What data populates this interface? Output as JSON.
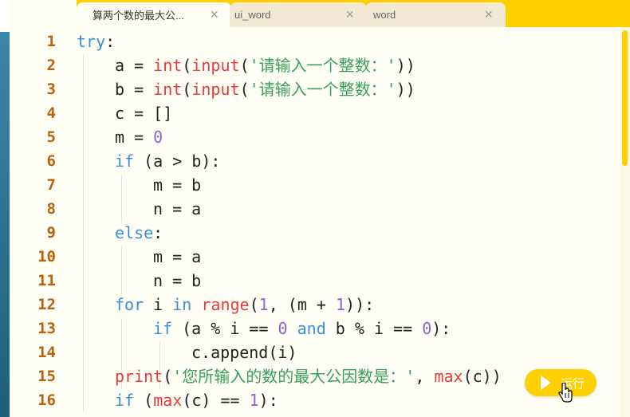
{
  "tabs": [
    {
      "label": "算两个数的最大公...",
      "active": true
    },
    {
      "label": "ui_word",
      "active": false
    },
    {
      "label": "word",
      "active": false
    }
  ],
  "close_glyph": "×",
  "run_button": {
    "label": "运行"
  },
  "line_numbers": [
    "1",
    "2",
    "3",
    "4",
    "5",
    "6",
    "7",
    "8",
    "9",
    "10",
    "11",
    "12",
    "13",
    "14",
    "15",
    "16"
  ],
  "code": {
    "l1": {
      "kw": "try",
      "rest": ":"
    },
    "l2": {
      "a": "a = ",
      "f1": "int",
      "p1": "(",
      "f2": "input",
      "p2": "(",
      "s": "'请输入一个整数：'",
      "p3": "))"
    },
    "l3": {
      "a": "b = ",
      "f1": "int",
      "p1": "(",
      "f2": "input",
      "p2": "(",
      "s": "'请输入一个整数：'",
      "p3": "))"
    },
    "l4": {
      "a": "c = []"
    },
    "l5": {
      "a": "m = ",
      "n": "0"
    },
    "l6": {
      "kw": "if",
      "rest": " (a > b):"
    },
    "l7": {
      "a": "m = b"
    },
    "l8": {
      "a": "n = a"
    },
    "l9": {
      "kw": "else",
      "rest": ":"
    },
    "l10": {
      "a": "m = a"
    },
    "l11": {
      "a": "n = b"
    },
    "l12": {
      "kw1": "for",
      "a": " i ",
      "kw2": "in",
      "b": " ",
      "f": "range",
      "c": "(",
      "n1": "1",
      "d": ", (m + ",
      "n2": "1",
      "e": ")):"
    },
    "l13": {
      "kw1": "if",
      "a": " (a % i == ",
      "n1": "0",
      "b": " ",
      "kw2": "and",
      "c": " b % i == ",
      "n2": "0",
      "d": "):"
    },
    "l14": {
      "a": "c.append(i)"
    },
    "l15": {
      "f1": "print",
      "a": "(",
      "s": "'您所输入的数的最大公因数是：'",
      "b": ", ",
      "f2": "max",
      "c": "(c))"
    },
    "l16": {
      "kw": "if",
      "a": " (",
      "f": "max",
      "b": "(c) == ",
      "n": "1",
      "c": "):"
    }
  },
  "colors": {
    "keyword": "#3a8fd6",
    "function": "#e23c3c",
    "string": "#3aa05a",
    "number": "#8c63d6",
    "line_number": "#b8620e",
    "accent": "#ffd000"
  }
}
